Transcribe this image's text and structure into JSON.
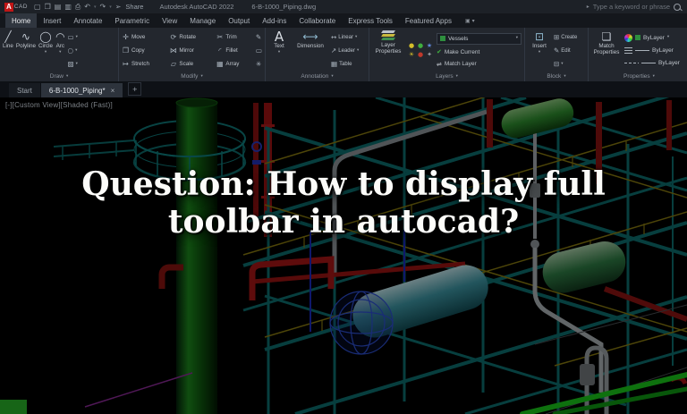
{
  "window": {
    "app_badge": "A",
    "app_badge_suffix": "CAD",
    "app_title": "Autodesk AutoCAD 2022",
    "doc_title": "6-B-1000_Piping.dwg",
    "share_label": "Share",
    "search_placeholder": "Type a keyword or phrase"
  },
  "ribbon": {
    "tabs": [
      "Home",
      "Insert",
      "Annotate",
      "Parametric",
      "View",
      "Manage",
      "Output",
      "Add-ins",
      "Collaborate",
      "Express Tools",
      "Featured Apps"
    ],
    "active_tab": "Home",
    "draw": {
      "label": "Draw",
      "buttons": [
        "Line",
        "Polyline",
        "Circle",
        "Arc"
      ]
    },
    "modify": {
      "label": "Modify",
      "buttons": [
        "Move",
        "Copy",
        "Stretch",
        "Rotate",
        "Mirror",
        "Scale",
        "Trim",
        "Fillet",
        "Array"
      ]
    },
    "annotation": {
      "label": "Annotation",
      "text": "Text",
      "dimension": "Dimension",
      "rows": [
        "Linear",
        "Leader",
        "Table"
      ]
    },
    "layers": {
      "label": "Layers",
      "properties_button": "Layer Properties",
      "layer_value": "Vessels",
      "make_current": "Make Current",
      "match_layer": "Match Layer"
    },
    "block": {
      "label": "Block",
      "insert": "Insert",
      "create": "Create",
      "edit": "Edit"
    },
    "properties": {
      "label": "Properties",
      "match_props": "Match Properties",
      "bylayer_color": "ByLayer",
      "bylayer_lineweight": "ByLayer",
      "bylayer_linetype": "ByLayer"
    }
  },
  "file_tabs": {
    "start": "Start",
    "document": "6-B-1000_Piping*"
  },
  "viewport": {
    "controls_label": "[-][Custom View][Shaded (Fast)]"
  },
  "overlay": {
    "title_line1": "Question: How to display full",
    "title_line2": "toolbar in autocad?"
  },
  "icons": {
    "new_file": "▢",
    "open_folder": "❒",
    "save": "▤",
    "save_as": "▥",
    "plot": "⎙",
    "undo": "↶",
    "redo": "↷",
    "share": "➢",
    "dropdown": "▾",
    "search_caret": "▸",
    "panel_toggle": "▣",
    "line": "╱",
    "polyline": "∿",
    "circle": "◯",
    "arc": "◠",
    "rectangle": "▭",
    "ellipse": "○",
    "hatch": "▨",
    "move": "✛",
    "copy": "❐",
    "stretch": "↦",
    "rotate": "⟳",
    "mirror": "⋈",
    "scale": "▱",
    "trim": "✂",
    "fillet": "◜",
    "array": "▦",
    "erase": "✎",
    "eraser": "▭",
    "explode": "✳",
    "text": "A",
    "dimension": "⟷",
    "linear": "↔",
    "leader": "↗",
    "table": "▦",
    "insert_block": "⊡",
    "create_block": "⊞",
    "edit_block": "✎",
    "block_attr": "⊟",
    "match_props": "❏",
    "make_current": "✔",
    "match_layer": "⇌",
    "layer_grid": [
      "●",
      "●",
      "★",
      "☀",
      "●",
      "✦"
    ],
    "close": "×",
    "plus": "+"
  },
  "colors": {
    "accent_red": "#c01616",
    "ribbon_bg": "#23272e",
    "titlebar_bg": "#1d2127",
    "viewport_bg": "#000000",
    "teal_structure": "#0d6f6f",
    "yellow_rails": "#8a7b10",
    "green_vessel": "#1d8a1d",
    "red_pipe": "#a01212",
    "cyan_exchanger": "#3e98a6",
    "overlay_text": "#fcfcf9"
  }
}
